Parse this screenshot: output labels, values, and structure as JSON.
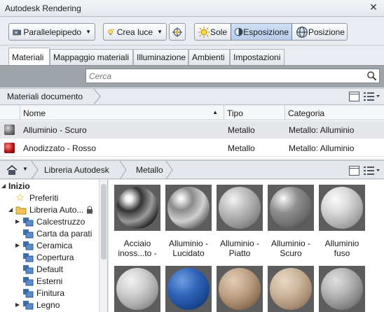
{
  "window": {
    "title": "Autodesk Rendering",
    "close_glyph": "✕"
  },
  "toolbar": {
    "projection_label": "Parallelepipedo",
    "create_light_label": "Crea luce",
    "sun_label": "Sole",
    "exposure_label": "Esposizione",
    "position_label": "Posizione"
  },
  "tabs": [
    "Materiali",
    "Mappaggio materiali",
    "Illuminazione",
    "Ambienti",
    "Impostazioni"
  ],
  "active_tab": "Materiali",
  "search": {
    "placeholder": "Cerca"
  },
  "document_materials": {
    "breadcrumb": "Materiali documento",
    "columns": [
      "Nome",
      "Tipo",
      "Categoria"
    ],
    "rows": [
      {
        "name": "Alluminio - Scuro",
        "type": "Metallo",
        "category": "Metallo: Alluminio",
        "swatch": "#7d7d7d"
      },
      {
        "name": "Anodizzato - Rosso",
        "type": "Metallo",
        "category": "Metallo: Alluminio",
        "swatch": "#b01818"
      }
    ]
  },
  "library": {
    "breadcrumb": [
      "Libreria Autodesk",
      "Metallo"
    ],
    "tree": [
      {
        "label": "Inizio",
        "bold": true,
        "expanded": true
      },
      {
        "label": "Preferiti",
        "icon": "star-icon"
      },
      {
        "label": "Libreria Auto...",
        "icon": "folder-icon",
        "expanded": true,
        "locked": true
      },
      {
        "label": "Calcestruzzo",
        "has_children": true
      },
      {
        "label": "Carta da parati"
      },
      {
        "label": "Ceramica",
        "has_children": true
      },
      {
        "label": "Copertura"
      },
      {
        "label": "Default"
      },
      {
        "label": "Esterni"
      },
      {
        "label": "Finitura"
      },
      {
        "label": "Legno",
        "has_children": true
      }
    ],
    "materials": [
      {
        "label": "Acciaio inoss...to -",
        "finish": "chrome"
      },
      {
        "label": "Alluminio - Lucidato",
        "finish": "polished"
      },
      {
        "label": "Alluminio - Piatto",
        "finish": "flat"
      },
      {
        "label": "Alluminio - Scuro",
        "finish": "dark"
      },
      {
        "label": "Alluminio fuso",
        "finish": "cast"
      },
      {
        "label": "",
        "finish": "hammered"
      },
      {
        "label": "",
        "finish": "blue"
      },
      {
        "label": "",
        "finish": "bronze"
      },
      {
        "label": "",
        "finish": "sand"
      },
      {
        "label": "",
        "finish": "grey-texture"
      }
    ]
  },
  "colors": {
    "selection": "#e4e6e9",
    "accent_blue": "#3a6fb0",
    "search_band": "#9fa4aa"
  }
}
